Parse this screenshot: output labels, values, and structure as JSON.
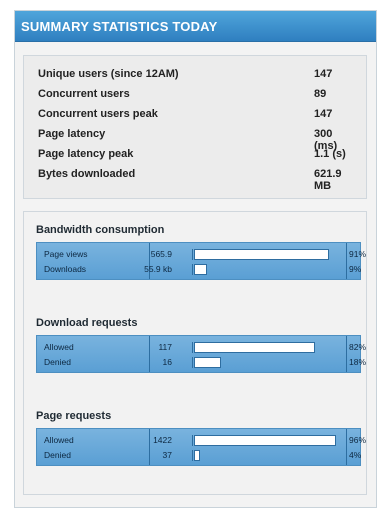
{
  "header": {
    "title": "SUMMARY STATISTICS TODAY"
  },
  "summary": [
    {
      "label": "Unique users (since 12AM)",
      "value": "147"
    },
    {
      "label": "Concurrent users",
      "value": "89"
    },
    {
      "label": "Concurrent users peak",
      "value": "147"
    },
    {
      "label": "Page latency",
      "value": "300 (ms)"
    },
    {
      "label": "Page latency peak",
      "value": "1.1 (s)"
    },
    {
      "label": "Bytes downloaded",
      "value": "621.9 MB"
    }
  ],
  "bandwidth": {
    "title": "Bandwidth consumption",
    "rows": [
      {
        "label": "Page views",
        "count": "565.9",
        "percent": "91%",
        "fraction": 0.91
      },
      {
        "label": "Downloads",
        "count": "55.9 kb",
        "percent": "9%",
        "fraction": 0.09
      }
    ]
  },
  "downloads": {
    "title": "Download requests",
    "rows": [
      {
        "label": "Allowed",
        "count": "117",
        "percent": "82%",
        "fraction": 0.82
      },
      {
        "label": "Denied",
        "count": "16",
        "percent": "18%",
        "fraction": 0.18
      }
    ]
  },
  "pages": {
    "title": "Page requests",
    "rows": [
      {
        "label": "Allowed",
        "count": "1422",
        "percent": "96%",
        "fraction": 0.96
      },
      {
        "label": "Denied",
        "count": "37",
        "percent": "4%",
        "fraction": 0.04
      }
    ]
  },
  "colors": {
    "header": "#3a8fcd",
    "bar_panel": "#6aa9da",
    "bar_fill": "#ffffff"
  }
}
